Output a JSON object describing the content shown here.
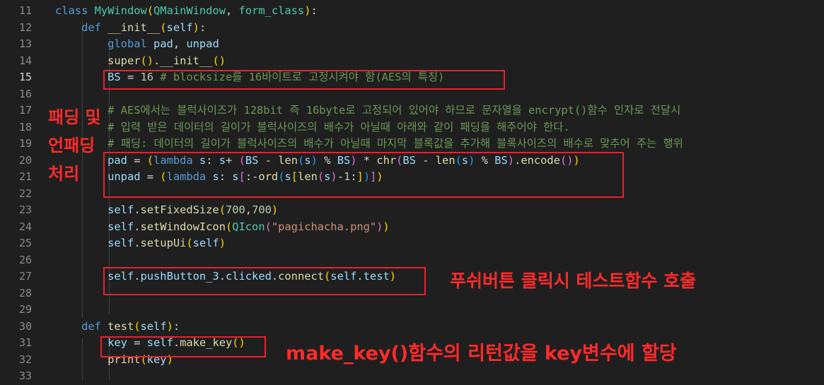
{
  "editor": {
    "lines": [
      {
        "n": "11",
        "segs": [
          [
            "kw",
            "class "
          ],
          [
            "cls",
            "MyWindow"
          ],
          [
            "b1",
            "("
          ],
          [
            "cls",
            "QMainWindow"
          ],
          [
            "op",
            ", "
          ],
          [
            "cls",
            "form_class"
          ],
          [
            "b1",
            ")"
          ],
          [
            "op",
            ":"
          ]
        ]
      },
      {
        "n": "12",
        "segs": [
          [
            "op",
            "    "
          ],
          [
            "kw",
            "def "
          ],
          [
            "fn",
            "__init__"
          ],
          [
            "b1",
            "("
          ],
          [
            "var",
            "self"
          ],
          [
            "b1",
            ")"
          ],
          [
            "op",
            ":"
          ]
        ]
      },
      {
        "n": "13",
        "segs": [
          [
            "op",
            "        "
          ],
          [
            "kw",
            "global "
          ],
          [
            "var",
            "pad"
          ],
          [
            "op",
            ", "
          ],
          [
            "var",
            "unpad"
          ]
        ]
      },
      {
        "n": "14",
        "segs": [
          [
            "op",
            "        "
          ],
          [
            "fn",
            "super"
          ],
          [
            "b1",
            "()"
          ],
          [
            "op",
            "."
          ],
          [
            "fn",
            "__init__"
          ],
          [
            "b1",
            "()"
          ]
        ]
      },
      {
        "n": "15",
        "active": true,
        "segs": [
          [
            "op",
            "        "
          ],
          [
            "var",
            "BS"
          ],
          [
            "op",
            " = "
          ],
          [
            "num",
            "16"
          ],
          [
            "cmt",
            " # blocksize를 16바이트로 고정시켜야 함(AES의 특징)"
          ]
        ]
      },
      {
        "n": "16",
        "segs": []
      },
      {
        "n": "17",
        "segs": [
          [
            "op",
            "        "
          ],
          [
            "cmt",
            "# AES에서는 블럭사이즈가 128bit 즉 16byte로 고정되어 있어야 하므로 문자열을 encrypt()함수 인자로 전달시"
          ]
        ]
      },
      {
        "n": "18",
        "segs": [
          [
            "op",
            "        "
          ],
          [
            "cmt",
            "# 입력 받은 데이터의 길이가 블럭사이즈의 배수가 아닐때 아래와 같이 패딩을 해주어야 한다."
          ]
        ]
      },
      {
        "n": "19",
        "segs": [
          [
            "op",
            "        "
          ],
          [
            "cmt",
            "# 패딩: 데이터의 길이가 블럭사이즈의 배수가 아닐때 마지막 블록값을 추가해 블록사이즈의 배수로 맞추어 주는 행위"
          ]
        ]
      },
      {
        "n": "20",
        "segs": [
          [
            "op",
            "        "
          ],
          [
            "var",
            "pad"
          ],
          [
            "op",
            " = "
          ],
          [
            "b1",
            "("
          ],
          [
            "kw",
            "lambda "
          ],
          [
            "var",
            "s"
          ],
          [
            "op",
            ": "
          ],
          [
            "var",
            "s"
          ],
          [
            "op",
            "+ "
          ],
          [
            "b2",
            "("
          ],
          [
            "var",
            "BS"
          ],
          [
            "op",
            " - "
          ],
          [
            "fn",
            "len"
          ],
          [
            "b3",
            "("
          ],
          [
            "var",
            "s"
          ],
          [
            "b3",
            ")"
          ],
          [
            "op",
            " % "
          ],
          [
            "var",
            "BS"
          ],
          [
            "b2",
            ")"
          ],
          [
            "op",
            " * "
          ],
          [
            "fn",
            "chr"
          ],
          [
            "b2",
            "("
          ],
          [
            "var",
            "BS"
          ],
          [
            "op",
            " - "
          ],
          [
            "fn",
            "len"
          ],
          [
            "b3",
            "("
          ],
          [
            "var",
            "s"
          ],
          [
            "b3",
            ")"
          ],
          [
            "op",
            " % "
          ],
          [
            "var",
            "BS"
          ],
          [
            "b2",
            ")"
          ],
          [
            "op",
            "."
          ],
          [
            "fn",
            "encode"
          ],
          [
            "b2",
            "()"
          ],
          [
            "b1",
            ")"
          ]
        ]
      },
      {
        "n": "21",
        "segs": [
          [
            "op",
            "        "
          ],
          [
            "var",
            "unpad"
          ],
          [
            "op",
            " = "
          ],
          [
            "b1",
            "("
          ],
          [
            "kw",
            "lambda "
          ],
          [
            "var",
            "s"
          ],
          [
            "op",
            ": "
          ],
          [
            "var",
            "s"
          ],
          [
            "b2",
            "["
          ],
          [
            "op",
            ":-"
          ],
          [
            "fn",
            "ord"
          ],
          [
            "b3",
            "("
          ],
          [
            "var",
            "s"
          ],
          [
            "b1",
            "["
          ],
          [
            "fn",
            "len"
          ],
          [
            "b2",
            "("
          ],
          [
            "var",
            "s"
          ],
          [
            "b2",
            ")"
          ],
          [
            "op",
            "-"
          ],
          [
            "num",
            "1"
          ],
          [
            "op",
            ":"
          ],
          [
            "b1",
            "]"
          ],
          [
            "b3",
            ")"
          ],
          [
            "b2",
            "]"
          ],
          [
            "b1",
            ")"
          ]
        ]
      },
      {
        "n": "22",
        "segs": []
      },
      {
        "n": "23",
        "segs": [
          [
            "op",
            "        "
          ],
          [
            "var",
            "self"
          ],
          [
            "op",
            "."
          ],
          [
            "fn",
            "setFixedSize"
          ],
          [
            "b1",
            "("
          ],
          [
            "num",
            "700"
          ],
          [
            "op",
            ","
          ],
          [
            "num",
            "700"
          ],
          [
            "b1",
            ")"
          ]
        ]
      },
      {
        "n": "24",
        "segs": [
          [
            "op",
            "        "
          ],
          [
            "var",
            "self"
          ],
          [
            "op",
            "."
          ],
          [
            "fn",
            "setWindowIcon"
          ],
          [
            "b1",
            "("
          ],
          [
            "cls",
            "QIcon"
          ],
          [
            "b2",
            "("
          ],
          [
            "str",
            "\"pagichacha.png\""
          ],
          [
            "b2",
            ")"
          ],
          [
            "b1",
            ")"
          ]
        ]
      },
      {
        "n": "25",
        "segs": [
          [
            "op",
            "        "
          ],
          [
            "var",
            "self"
          ],
          [
            "op",
            "."
          ],
          [
            "fn",
            "setupUi"
          ],
          [
            "b1",
            "("
          ],
          [
            "var",
            "self"
          ],
          [
            "b1",
            ")"
          ]
        ]
      },
      {
        "n": "26",
        "segs": []
      },
      {
        "n": "27",
        "segs": [
          [
            "op",
            "        "
          ],
          [
            "var",
            "self"
          ],
          [
            "op",
            "."
          ],
          [
            "var",
            "pushButton_3"
          ],
          [
            "op",
            "."
          ],
          [
            "var",
            "clicked"
          ],
          [
            "op",
            "."
          ],
          [
            "fn",
            "connect"
          ],
          [
            "b1",
            "("
          ],
          [
            "var",
            "self"
          ],
          [
            "op",
            "."
          ],
          [
            "var",
            "test"
          ],
          [
            "b1",
            ")"
          ]
        ]
      },
      {
        "n": "28",
        "segs": []
      },
      {
        "n": "29",
        "segs": []
      },
      {
        "n": "30",
        "segs": [
          [
            "op",
            "    "
          ],
          [
            "kw",
            "def "
          ],
          [
            "fn",
            "test"
          ],
          [
            "b1",
            "("
          ],
          [
            "var",
            "self"
          ],
          [
            "b1",
            ")"
          ],
          [
            "op",
            ":"
          ]
        ]
      },
      {
        "n": "31",
        "segs": [
          [
            "op",
            "        "
          ],
          [
            "var",
            "key"
          ],
          [
            "op",
            " = "
          ],
          [
            "var",
            "self"
          ],
          [
            "op",
            "."
          ],
          [
            "fn",
            "make_key"
          ],
          [
            "b1",
            "()"
          ]
        ]
      },
      {
        "n": "32",
        "segs": [
          [
            "op",
            "        "
          ],
          [
            "fn",
            "print"
          ],
          [
            "b1",
            "("
          ],
          [
            "var",
            "key"
          ],
          [
            "b1",
            ")"
          ]
        ]
      },
      {
        "n": "33",
        "segs": []
      }
    ]
  },
  "annotations": {
    "padding_title_1": "패딩 및",
    "padding_title_2": "언패딩",
    "padding_title_3": "처리",
    "push_button_note": "푸쉬버튼 클릭시 테스트함수 호출",
    "make_key_note": "make_key()함수의 리턴값을 key변수에 할당"
  },
  "colors": {
    "background": "#1f1f1f",
    "annotation_red": "#e8222e"
  }
}
